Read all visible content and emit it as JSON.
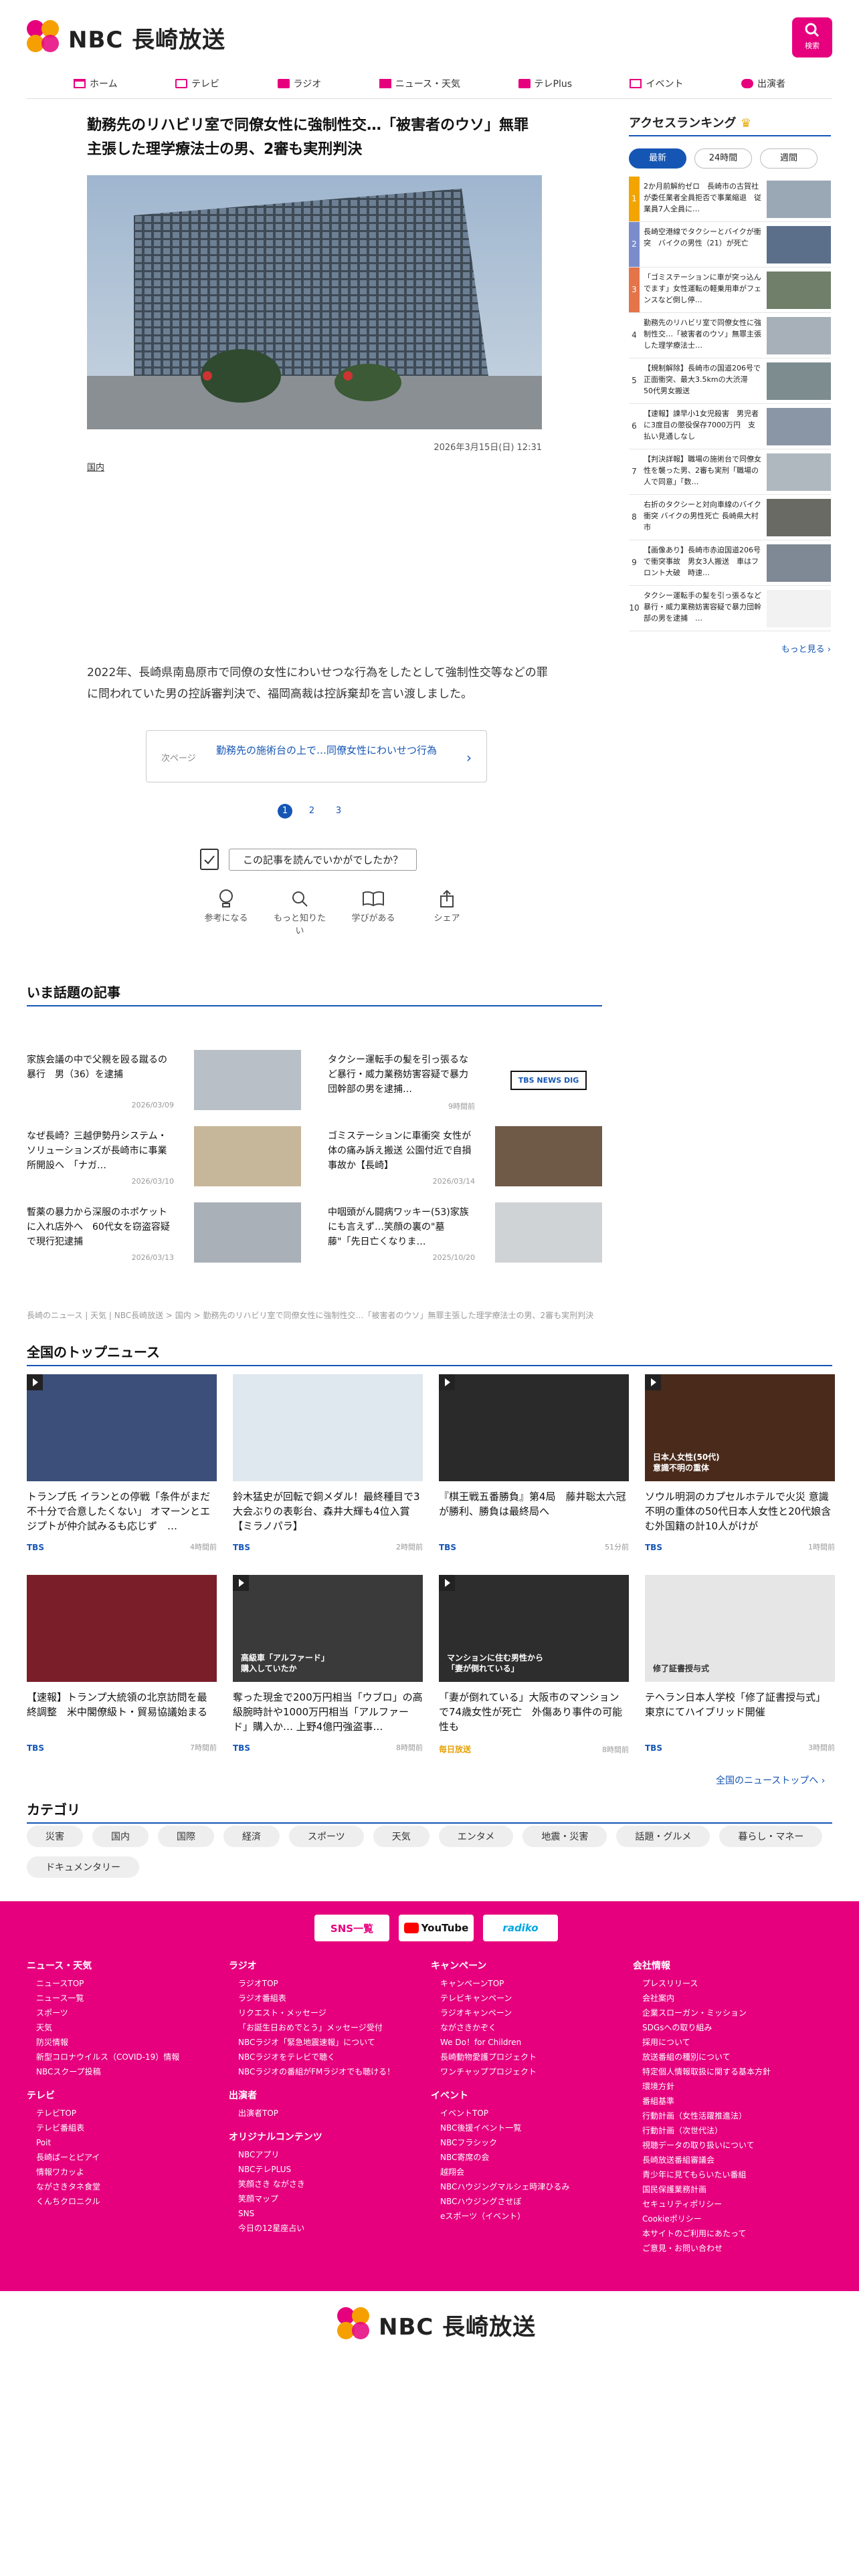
{
  "header": {
    "logo": "NBC 長崎放送",
    "search_label": "検索"
  },
  "nav": [
    "ホーム",
    "テレビ",
    "ラジオ",
    "ニュース・天気",
    "テレPlus",
    "イベント",
    "出演者"
  ],
  "article": {
    "headline": "勤務先のリハビリ室で同僚女性に強制性交…「被害者のウソ」無罪主張した理学療法士の男、2審も実刑判決",
    "date": "2026年3月15日(日) 12:31",
    "tag": "国内",
    "lead": "2022年、長崎県南島原市で同僚の女性にわいせつな行為をしたとして強制性交等などの罪に問われていた男の控訴審判決で、福岡高裁は控訴棄却を言い渡しました。",
    "next_label": "次ページ",
    "next_text": "勤務先の施術台の上で…同僚女性にわいせつ行為",
    "pages": [
      "1",
      "2",
      "3"
    ],
    "feedback": "この記事を読んでいかがでしたか？",
    "reactions": [
      "参考になる",
      "もっと知りたい",
      "学びがある",
      "シェア"
    ]
  },
  "ranking": {
    "title": "アクセスランキング",
    "tabs": [
      "最新",
      "24時間",
      "週間"
    ],
    "items": [
      {
        "no": "1",
        "text": "2か月前解約ゼロ　長崎市の古賀社が委任業者全員拒否で事業縮退　従業員7人全員に…"
      },
      {
        "no": "2",
        "text": "長崎空港線でタクシーとバイクが衝突　バイクの男性（21）が死亡"
      },
      {
        "no": "3",
        "text": "「ゴミステーションに車が突っ込んでます」女性運転の軽乗用車がフェンスなど倒し停…"
      },
      {
        "no": "4",
        "text": "勤務先のリハビリ室で同僚女性に強制性交…「被害者のウソ」無罪主張した理学療法士…"
      },
      {
        "no": "5",
        "text": "【規制解除】長崎市の国道206号で正面衝突、最大3.5kmの大渋滞　50代男女搬送"
      },
      {
        "no": "6",
        "text": "【速報】諫早小1女児殺害　男児者に3度目の懲役保存7000万円　支払い見通しなし"
      },
      {
        "no": "7",
        "text": "【判決詳報】職場の施術台で同僚女性を襲った男、2審も実刑「職場の人で同意」「数…"
      },
      {
        "no": "8",
        "text": "右折のタクシーと対向車線のバイク衝突 バイクの男性死亡 長崎県大村市"
      },
      {
        "no": "9",
        "text": "【画像あり】長崎市赤迫国道206号で衝突事故　男女3人搬送　車はフロント大破　時速…"
      },
      {
        "no": "10",
        "text": "タクシー運転手の髪を引っ張るなど暴行・威力業務妨害容疑で暴力団幹部の男を逮捕　…"
      }
    ],
    "more": "もっと見る ›"
  },
  "topics": {
    "title": "いま話題の記事",
    "items": [
      {
        "title": "家族会議の中で父親を殴る蹴るの暴行　男（36）を逮捕",
        "date": "2026/03/09"
      },
      {
        "title": "タクシー運転手の髪を引っ張るなど暴行・威力業務妨害容疑で暴力団幹部の男を逮捕…",
        "date": "9時間前"
      },
      {
        "title": "なぜ長崎？三越伊勢丹システム・ソリューションズが長崎市に事業所開設へ　「ナガ…",
        "date": "2026/03/10"
      },
      {
        "title": "ゴミステーションに車衝突 女性が体の痛み訴え搬送 公園付近で自損事故か【長崎】",
        "date": "2026/03/14"
      },
      {
        "title": "暫薬の暴力から深服のホポケットに入れ店外へ　60代女を窃盗容疑で現行犯逮捕",
        "date": "2026/03/13"
      },
      {
        "title": "中咽頭がん闘病ワッキー(53)家族にも言えず…笑顔の裏の\"墓藤\"「先日亡くなりま…",
        "date": "2025/10/20"
      }
    ],
    "tbs_logo": "TBS NEWS DIG"
  },
  "breadcrumb": "長崎のニュース | 天気 | NBC長崎放送 > 国内 > 勤務先のリハビリ室で同僚女性に強制性交…「被害者のウソ」無罪主張した理学療法士の男、2審も実刑判決",
  "national": {
    "title": "全国のトップニュース",
    "items": [
      {
        "title": "トランプ氏 イランとの停戦「条件がまだ不十分で合意したくない」 オマーンとエジプトが仲介試みるも応じず　…",
        "src": "TBS",
        "time": "4時間前"
      },
      {
        "title": "鈴木猛史が回転で銅メダル！最終種目で3大会ぶりの表彰台、森井大輝も4位入賞【ミラノパラ】",
        "src": "TBS",
        "time": "2時間前"
      },
      {
        "title": "『棋王戦五番勝負』第4局　藤井聡太六冠が勝利、勝負は最終局へ",
        "src": "TBS",
        "time": "51分前"
      },
      {
        "title": "ソウル明洞のカプセルホテルで火災 意識不明の重体の50代日本人女性と20代娘含む外国籍の計10人がけが",
        "src": "TBS",
        "time": "1時間前"
      },
      {
        "title": "【速報】トランプ大統領の北京訪問を最終調整　米中閣僚級ト・貿易協議始まる",
        "src": "TBS",
        "time": "7時間前"
      },
      {
        "title": "奪った現金で200万円相当「ウブロ」の高級腕時計や1000万円相当「アルファード」購入か… 上野4億円強盗事…",
        "src": "TBS",
        "time": "8時間前"
      },
      {
        "title": "「妻が倒れている」大阪市のマンションで74歳女性が死亡　外傷あり事件の可能性も",
        "src": "毎日放送",
        "time": "8時間前"
      },
      {
        "title": "テヘラン日本人学校「修了証書授与式」東京にてハイブリッド開催",
        "src": "TBS",
        "time": "3時間前"
      }
    ],
    "img_texts": [
      "",
      "",
      "",
      "日本人女性(50代)\n意識不明の重体",
      "",
      "高級車「アルファード」\n購入していたか",
      "マンションに住む男性から\n「妻が倒れている」",
      "修了証書授与式"
    ],
    "all_link": "全国のニューストップへ ›"
  },
  "categories": {
    "title": "カテゴリ",
    "items": [
      "災害",
      "国内",
      "国際",
      "経済",
      "スポーツ",
      "天気",
      "エンタメ",
      "地震・災害",
      "話題・グルメ",
      "暮らし・マネー",
      "ドキュメンタリー"
    ]
  },
  "footer": {
    "sns": [
      "SNS一覧",
      "YouTube",
      "radiko"
    ],
    "cols": [
      {
        "groups": [
          {
            "h": "ニュース・天気",
            "items": [
              "ニュースTOP",
              "ニュース一覧",
              "スポーツ",
              "天気",
              "防災情報",
              "新型コロナウイルス（COVID-19）情報",
              "NBCスクープ投稿"
            ]
          },
          {
            "h": "テレビ",
            "items": [
              "テレビTOP",
              "テレビ番組表",
              "Poit",
              "長崎ばーとピアイ",
              "情報ワカッよ",
              "ながさきタネ食堂",
              "くんちクロニクル"
            ]
          }
        ]
      },
      {
        "groups": [
          {
            "h": "ラジオ",
            "items": [
              "ラジオTOP",
              "ラジオ番組表",
              "リクエスト・メッセージ",
              "「お誕生日おめでとう」メッセージ受付",
              "NBCラジオ「緊急地震速報」について",
              "NBCラジオをテレビで聴く",
              "NBCラジオの番組がFMラジオでも聴ける！"
            ]
          },
          {
            "h": "出演者",
            "items": [
              "出演者TOP"
            ]
          },
          {
            "h": "オリジナルコンテンツ",
            "items": [
              "NBCアプリ",
              "NBCテレPLUS",
              "笑顔さき ながさき",
              "笑顔マップ",
              "SNS",
              "今日の12星座占い"
            ]
          }
        ]
      },
      {
        "groups": [
          {
            "h": "キャンペーン",
            "items": [
              "キャンペーンTOP",
              "テレビキャンペーン",
              "ラジオキャンペーン",
              "ながさきかぞく",
              "We Do！for Children",
              "長崎動物愛護プロジェクト",
              "ワンチャッププロジェクト"
            ]
          },
          {
            "h": "イベント",
            "items": [
              "イベントTOP",
              "NBC後援イベント一覧",
              "NBCフラシック",
              "NBC寄席の会",
              "越翔会",
              "NBCハウジングマルシェ時津ひるみ",
              "NBCハウジングさせぼ",
              "eスポーツ（イベント）"
            ]
          }
        ]
      },
      {
        "groups": [
          {
            "h": "会社情報",
            "items": [
              "プレスリリース",
              "会社案内",
              "企業スローガン・ミッション",
              "SDGsへの取り組み",
              "採用について",
              "放送番組の種別について",
              "特定個人情報取扱に関する基本方針",
              "環境方針",
              "番組基準",
              "行動計画（女性活躍推進法）",
              "行動計画（次世代法）",
              "視聴データの取り扱いについて",
              "長崎放送番組審議会",
              "青少年に見てもらいたい番組",
              "国民保護業務計画",
              "セキュリティポリシー",
              "Cookieポリシー",
              "本サイトのご利用にあたって",
              "ご意見・お問い合わせ"
            ]
          }
        ]
      }
    ]
  },
  "colors": {
    "brand": "#e6007e",
    "accent": "#1556b5"
  }
}
